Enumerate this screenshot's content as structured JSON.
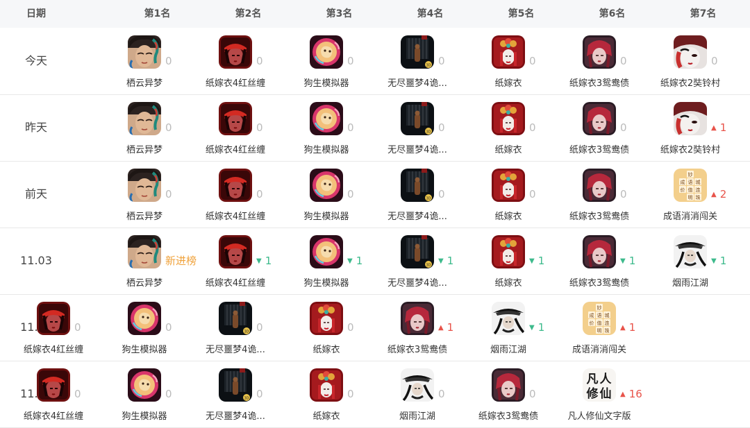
{
  "header": {
    "date_label": "日期",
    "rank_labels": [
      "第1名",
      "第2名",
      "第3名",
      "第4名",
      "第5名",
      "第6名",
      "第7名"
    ]
  },
  "colors": {
    "up": "#e8534a",
    "down": "#3dba8c",
    "new": "#f0a23b",
    "zero": "#bbbbbb"
  },
  "rows": [
    {
      "date": "今天",
      "cells": [
        {
          "name": "栖云异梦",
          "icon": "qiyun",
          "change": "0",
          "dir": "zero"
        },
        {
          "name": "纸嫁衣4红丝缠",
          "icon": "zhijiayi4",
          "change": "0",
          "dir": "zero"
        },
        {
          "name": "狗生模拟器",
          "icon": "gousheng",
          "change": "0",
          "dir": "zero"
        },
        {
          "name": "无尽噩梦4诡...",
          "icon": "wujin",
          "change": "0",
          "dir": "zero"
        },
        {
          "name": "纸嫁衣",
          "icon": "zhijiayi",
          "change": "0",
          "dir": "zero"
        },
        {
          "name": "纸嫁衣3鸳鸯债",
          "icon": "zhijiayi3",
          "change": "0",
          "dir": "zero"
        },
        {
          "name": "纸嫁衣2奘铃村",
          "icon": "zhijiayi2",
          "change": "0",
          "dir": "zero"
        }
      ]
    },
    {
      "date": "昨天",
      "cells": [
        {
          "name": "栖云异梦",
          "icon": "qiyun",
          "change": "0",
          "dir": "zero"
        },
        {
          "name": "纸嫁衣4红丝缠",
          "icon": "zhijiayi4",
          "change": "0",
          "dir": "zero"
        },
        {
          "name": "狗生模拟器",
          "icon": "gousheng",
          "change": "0",
          "dir": "zero"
        },
        {
          "name": "无尽噩梦4诡...",
          "icon": "wujin",
          "change": "0",
          "dir": "zero"
        },
        {
          "name": "纸嫁衣",
          "icon": "zhijiayi",
          "change": "0",
          "dir": "zero"
        },
        {
          "name": "纸嫁衣3鸳鸯债",
          "icon": "zhijiayi3",
          "change": "0",
          "dir": "zero"
        },
        {
          "name": "纸嫁衣2奘铃村",
          "icon": "zhijiayi2",
          "change": "1",
          "dir": "up"
        }
      ]
    },
    {
      "date": "前天",
      "cells": [
        {
          "name": "栖云异梦",
          "icon": "qiyun",
          "change": "0",
          "dir": "zero"
        },
        {
          "name": "纸嫁衣4红丝缠",
          "icon": "zhijiayi4",
          "change": "0",
          "dir": "zero"
        },
        {
          "name": "狗生模拟器",
          "icon": "gousheng",
          "change": "0",
          "dir": "zero"
        },
        {
          "name": "无尽噩梦4诡...",
          "icon": "wujin",
          "change": "0",
          "dir": "zero"
        },
        {
          "name": "纸嫁衣",
          "icon": "zhijiayi",
          "change": "0",
          "dir": "zero"
        },
        {
          "name": "纸嫁衣3鸳鸯债",
          "icon": "zhijiayi3",
          "change": "0",
          "dir": "zero"
        },
        {
          "name": "成语消消闯关",
          "icon": "chengyu",
          "change": "2",
          "dir": "up"
        }
      ]
    },
    {
      "date": "11.03",
      "cells": [
        {
          "name": "栖云异梦",
          "icon": "qiyun",
          "change": "新进榜",
          "dir": "new"
        },
        {
          "name": "纸嫁衣4红丝缠",
          "icon": "zhijiayi4",
          "change": "1",
          "dir": "down"
        },
        {
          "name": "狗生模拟器",
          "icon": "gousheng",
          "change": "1",
          "dir": "down"
        },
        {
          "name": "无尽噩梦4诡...",
          "icon": "wujin",
          "change": "1",
          "dir": "down"
        },
        {
          "name": "纸嫁衣",
          "icon": "zhijiayi",
          "change": "1",
          "dir": "down"
        },
        {
          "name": "纸嫁衣3鸳鸯债",
          "icon": "zhijiayi3",
          "change": "1",
          "dir": "down"
        },
        {
          "name": "烟雨江湖",
          "icon": "yanyu",
          "change": "1",
          "dir": "down"
        }
      ]
    },
    {
      "date": "11.02",
      "cells": [
        {
          "name": "纸嫁衣4红丝缠",
          "icon": "zhijiayi4",
          "change": "0",
          "dir": "zero"
        },
        {
          "name": "狗生模拟器",
          "icon": "gousheng",
          "change": "0",
          "dir": "zero"
        },
        {
          "name": "无尽噩梦4诡...",
          "icon": "wujin",
          "change": "0",
          "dir": "zero"
        },
        {
          "name": "纸嫁衣",
          "icon": "zhijiayi",
          "change": "0",
          "dir": "zero"
        },
        {
          "name": "纸嫁衣3鸳鸯债",
          "icon": "zhijiayi3",
          "change": "1",
          "dir": "up"
        },
        {
          "name": "烟雨江湖",
          "icon": "yanyu",
          "change": "1",
          "dir": "down"
        },
        {
          "name": "成语消消闯关",
          "icon": "chengyu",
          "change": "1",
          "dir": "up"
        }
      ]
    },
    {
      "date": "11.01",
      "cells": [
        {
          "name": "纸嫁衣4红丝缠",
          "icon": "zhijiayi4",
          "change": "0",
          "dir": "zero"
        },
        {
          "name": "狗生模拟器",
          "icon": "gousheng",
          "change": "0",
          "dir": "zero"
        },
        {
          "name": "无尽噩梦4诡...",
          "icon": "wujin",
          "change": "0",
          "dir": "zero"
        },
        {
          "name": "纸嫁衣",
          "icon": "zhijiayi",
          "change": "0",
          "dir": "zero"
        },
        {
          "name": "烟雨江湖",
          "icon": "yanyu",
          "change": "0",
          "dir": "zero"
        },
        {
          "name": "纸嫁衣3鸳鸯债",
          "icon": "zhijiayi3",
          "change": "0",
          "dir": "zero"
        },
        {
          "name": "凡人修仙文字版",
          "icon": "fanren",
          "change": "16",
          "dir": "up"
        }
      ]
    }
  ]
}
